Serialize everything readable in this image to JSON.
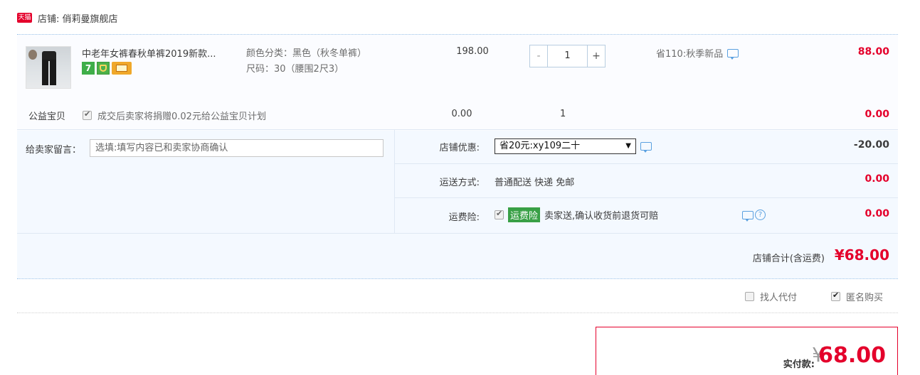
{
  "store": {
    "badge": "天猫",
    "label": "店铺: 俏莉曼旗舰店"
  },
  "item": {
    "title": "中老年女裤春秋单裤2019新款...",
    "icon_seven": "7",
    "sku_color": "颜色分类：黑色（秋冬单裤）",
    "sku_size": "尺码：30（腰围2尺3）",
    "price": "198.00",
    "quantity_minus": "-",
    "quantity": "1",
    "quantity_plus": "+",
    "promo": "省110:秋季新品",
    "subtotal": "88.00"
  },
  "charity": {
    "label": "公益宝贝",
    "text": "成交后卖家将捐赠0.02元给公益宝贝计划",
    "price": "0.00",
    "qty": "1",
    "subtotal": "0.00"
  },
  "message": {
    "label": "给卖家留言：",
    "placeholder": "选填:填写内容已和卖家协商确认"
  },
  "store_discount": {
    "label": "店铺优惠:",
    "selected": "省20元:xy109二十",
    "amount": "-20.00"
  },
  "shipping": {
    "label": "运送方式:",
    "value": "普通配送 快递 免邮",
    "amount": "0.00"
  },
  "insurance": {
    "label": "运费险:",
    "badge": "运费险",
    "text": "卖家送,确认收货前退货可赔",
    "amount": "0.00"
  },
  "store_total": {
    "label": "店铺合计(含运费)",
    "value": "¥68.00"
  },
  "options": {
    "proxy_pay": "找人代付",
    "anonymous": "匿名购买"
  },
  "payment": {
    "label": "实付款:",
    "currency": "¥",
    "value": "68.00"
  },
  "colors": {
    "accent_red": "#e4002b",
    "link_blue": "#5aa0e0",
    "insurance_green": "#39a046"
  }
}
